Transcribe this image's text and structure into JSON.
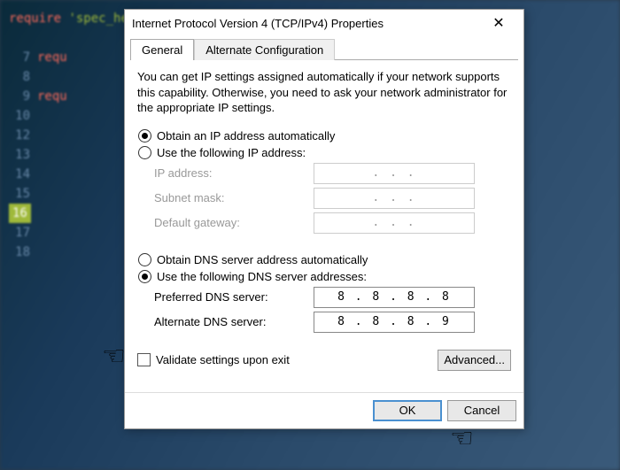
{
  "code": {
    "line1_kw": "require",
    "line1_st": "'spec_helper'",
    "line7_kw": "requ",
    "line9_kw": "requ"
  },
  "dialog": {
    "title": "Internet Protocol Version 4 (TCP/IPv4) Properties",
    "tabs": {
      "general": "General",
      "alternate": "Alternate Configuration"
    },
    "info": "You can get IP settings assigned automatically if your network supports this capability. Otherwise, you need to ask your network administrator for the appropriate IP settings.",
    "ip": {
      "auto": "Obtain an IP address automatically",
      "manual": "Use the following IP address:",
      "address_label": "IP address:",
      "subnet_label": "Subnet mask:",
      "gateway_label": "Default gateway:",
      "dots": ".       .       ."
    },
    "dns": {
      "auto": "Obtain DNS server address automatically",
      "manual": "Use the following DNS server addresses:",
      "preferred_label": "Preferred DNS server:",
      "alternate_label": "Alternate DNS server:",
      "preferred_value": "8 . 8 . 8 . 8",
      "alternate_value": "8 . 8 . 8 . 9"
    },
    "validate": "Validate settings upon exit",
    "advanced": "Advanced...",
    "ok": "OK",
    "cancel": "Cancel"
  }
}
